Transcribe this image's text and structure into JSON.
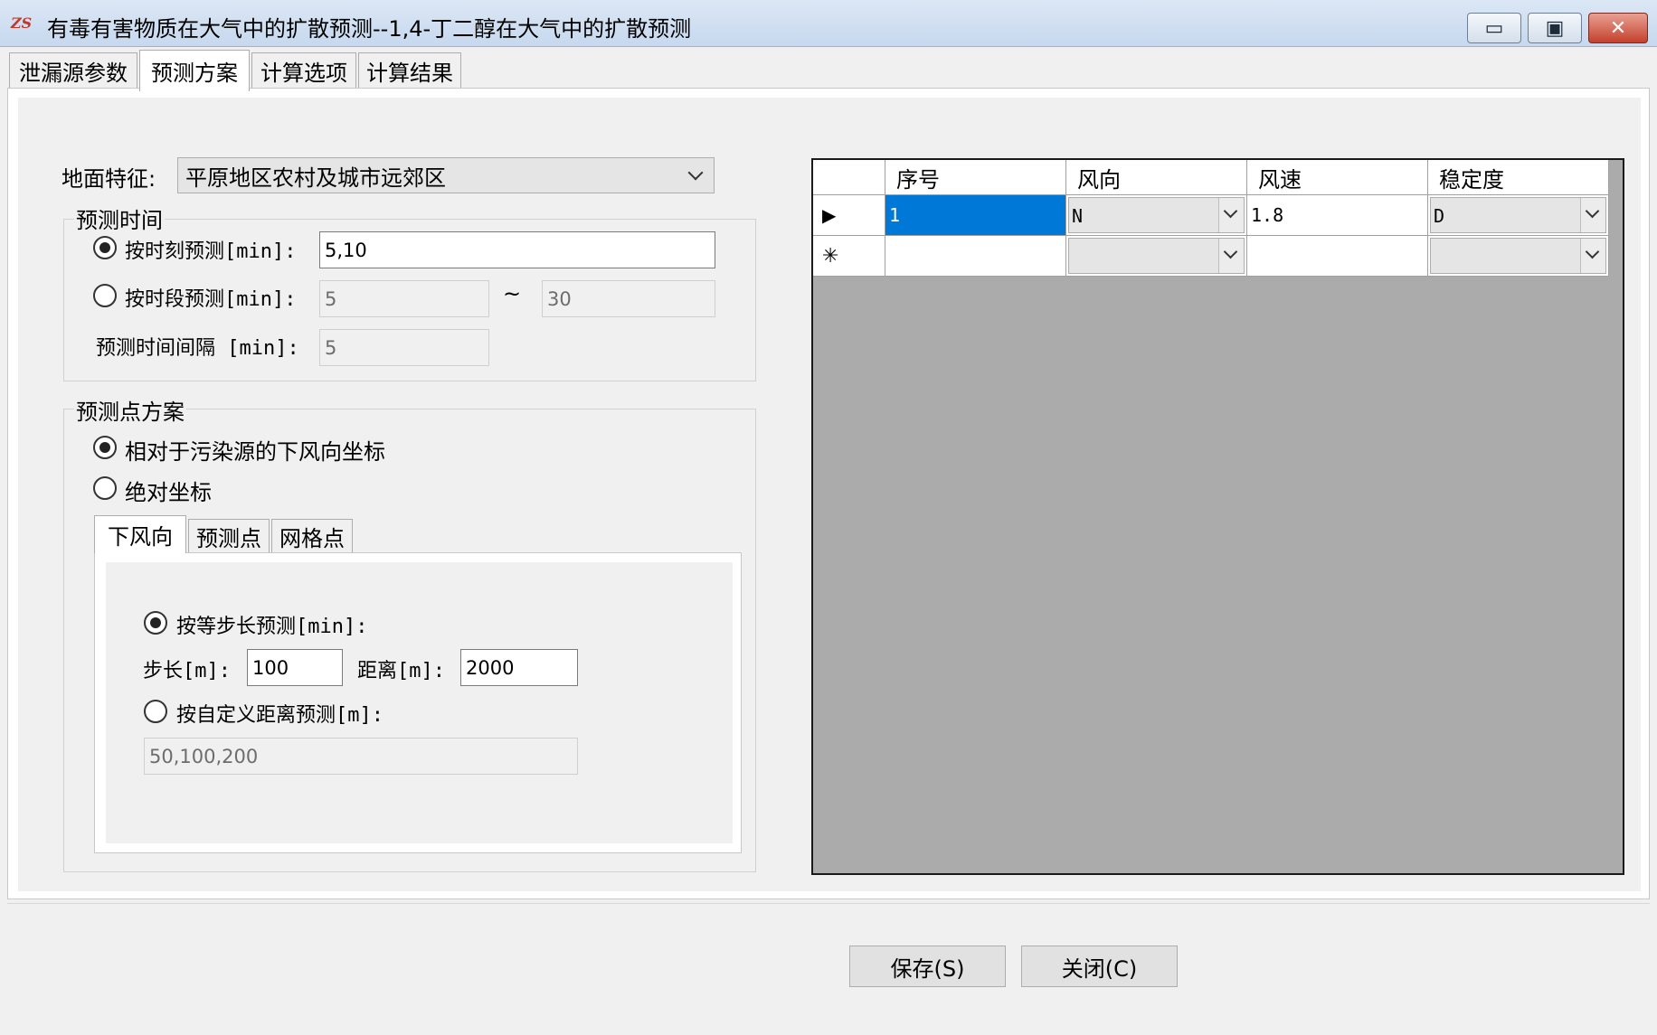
{
  "window": {
    "icon_text": "ZS",
    "title": "有毒有害物质在大气中的扩散预测--1,4-丁二醇在大气中的扩散预测",
    "minimize": "▭",
    "maximize": "▣",
    "close": "✕"
  },
  "tabs": [
    "泄漏源参数",
    "预测方案",
    "计算选项",
    "计算结果"
  ],
  "ground": {
    "label": "地面特征:",
    "value": "平原地区农村及城市远郊区"
  },
  "time_group": {
    "title": "预测时间",
    "by_moment_label": "按时刻预测[min]:",
    "by_moment_value": "5,10",
    "by_period_label": "按时段预测[min]:",
    "period_from": "5",
    "tilde": "~",
    "period_to": "30",
    "interval_label": "预测时间间隔 [min]:",
    "interval_value": "5"
  },
  "points_group": {
    "title": "预测点方案",
    "relative_label": "相对于污染源的下风向坐标",
    "absolute_label": "绝对坐标",
    "subtabs": [
      "下风向",
      "预测点",
      "网格点"
    ],
    "equal_step_label": "按等步长预测[min]:",
    "step_label": "步长[m]:",
    "step_value": "100",
    "distance_label": "距离[m]:",
    "distance_value": "2000",
    "custom_label": "按自定义距离预测[m]:",
    "custom_value": "50,100,200"
  },
  "grid": {
    "headers": [
      "序号",
      "风向",
      "风速",
      "稳定度"
    ],
    "row_pointer": "▶",
    "new_row_marker": "✳",
    "rows": [
      {
        "seq": "1",
        "direction": "N",
        "speed": "1.8",
        "stability": "D"
      }
    ]
  },
  "buttons": {
    "save": "保存(S)",
    "close": "关闭(C)"
  }
}
